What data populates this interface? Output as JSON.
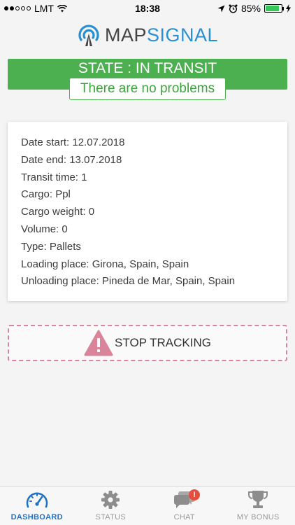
{
  "status_bar": {
    "carrier": "LMT",
    "time": "18:38",
    "battery": "85%",
    "battery_level": 0.85
  },
  "logo": {
    "part1": "MAP",
    "part2": "SIGNAL"
  },
  "state": {
    "title": "STATE : IN TRANSIT",
    "message": "There are no problems"
  },
  "info": {
    "lines": [
      "Date start: 12.07.2018",
      "Date end: 13.07.2018",
      "Transit time: 1",
      "Cargo: Ppl",
      "Cargo weight: 0",
      "Volume: 0",
      "Type: Pallets",
      "Loading place: Girona, Spain, Spain",
      "Unloading place: Pineda de Mar, Spain, Spain"
    ]
  },
  "stop_button": {
    "label": "STOP TRACKING"
  },
  "tabs": [
    {
      "label": "DASHBOARD",
      "icon": "speedometer-icon",
      "active": true
    },
    {
      "label": "STATUS",
      "icon": "gear-icon"
    },
    {
      "label": "CHAT",
      "icon": "chat-icon",
      "badge": "!"
    },
    {
      "label": "MY BONUS",
      "icon": "trophy-icon"
    }
  ],
  "colors": {
    "green": "#4caf50",
    "blue": "#1f72c6",
    "dashed_pink": "#d9849b",
    "badge_red": "#e74c3c"
  }
}
